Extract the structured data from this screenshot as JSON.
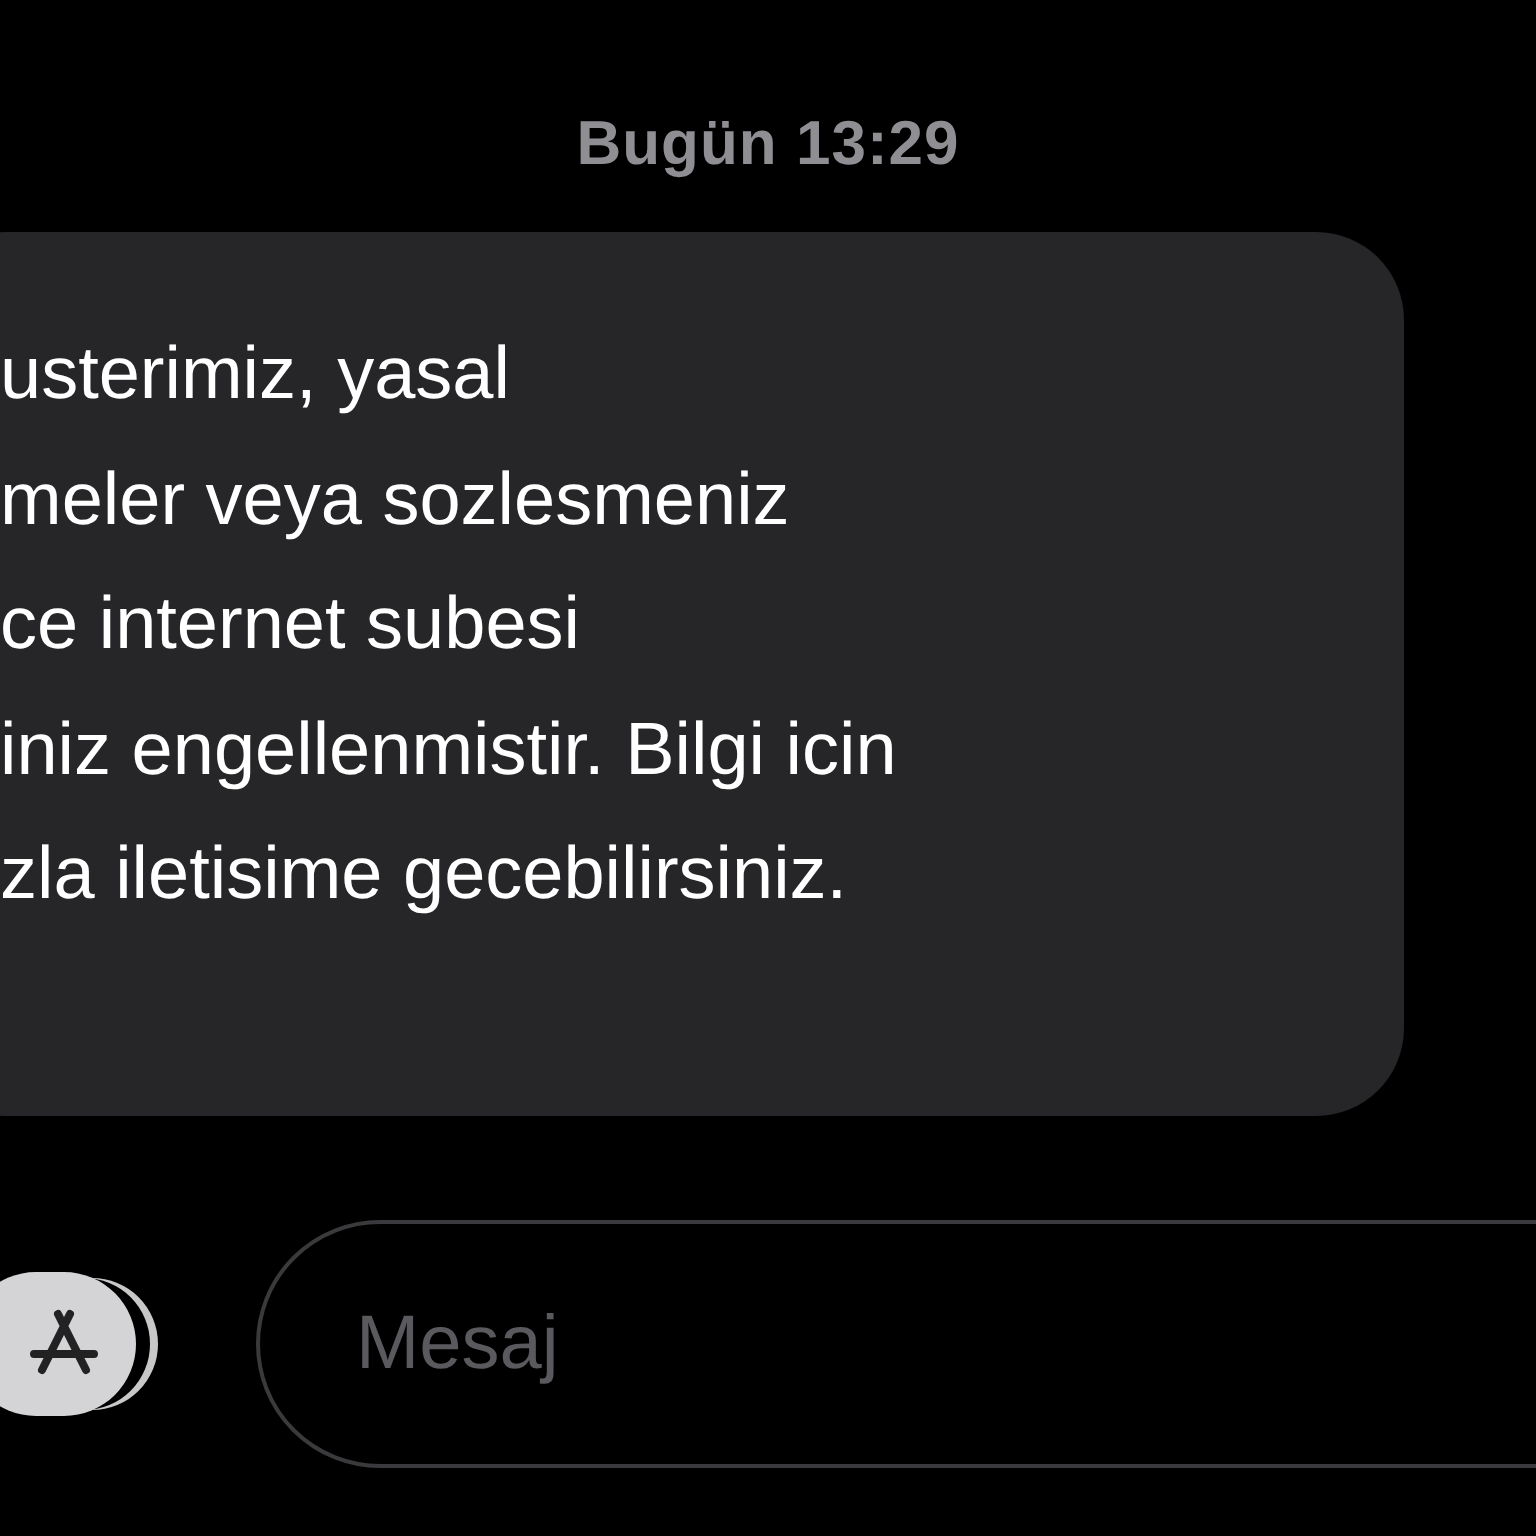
{
  "timestamp": "Bugün 13:29",
  "message": {
    "text": "usterimiz, yasal\nmeler veya sozlesmeniz\nce internet subesi\niniz engellenmistir. Bilgi icin\nzla iletisime gecebilirsiniz."
  },
  "composer": {
    "placeholder": "Mesaj"
  }
}
